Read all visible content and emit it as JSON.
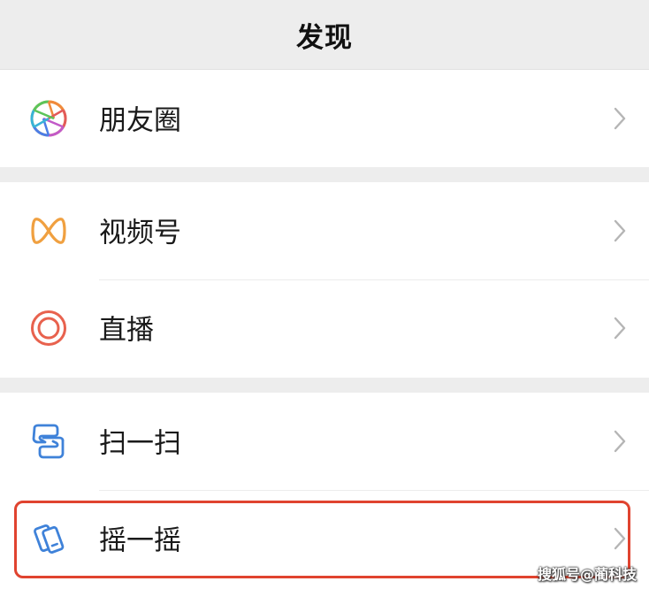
{
  "header": {
    "title": "发现"
  },
  "groups": [
    {
      "items": [
        {
          "label": "朋友圈",
          "icon": "moments-icon"
        }
      ]
    },
    {
      "items": [
        {
          "label": "视频号",
          "icon": "channels-icon"
        },
        {
          "label": "直播",
          "icon": "live-icon"
        }
      ]
    },
    {
      "items": [
        {
          "label": "扫一扫",
          "icon": "scan-icon"
        },
        {
          "label": "摇一摇",
          "icon": "shake-icon"
        }
      ]
    }
  ],
  "colors": {
    "background": "#ededed",
    "row_bg": "#ffffff",
    "channels": "#f0a040",
    "live": "#e8624e",
    "scan_shake": "#3f82d9",
    "highlight": "#e0432f"
  },
  "watermark": "搜狐号@蔺科技"
}
